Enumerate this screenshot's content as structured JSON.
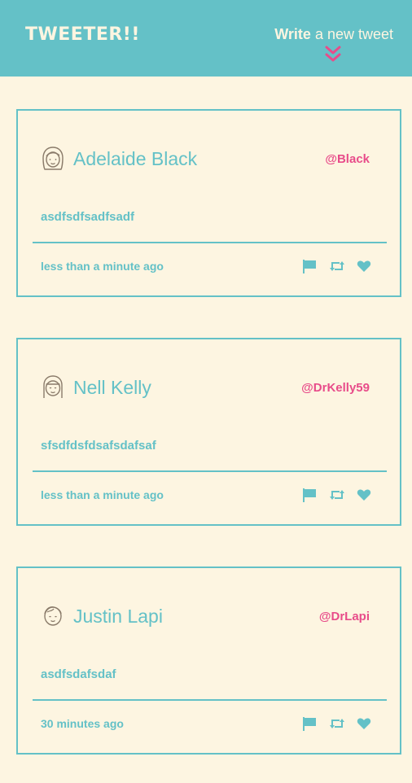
{
  "header": {
    "brand": "TWEETER!!",
    "compose_bold": "Write",
    "compose_rest": " a new tweet",
    "compose_icon": "double-chevron-down-icon"
  },
  "colors": {
    "background": "#fdf5e1",
    "accent": "#64c1c7",
    "handle": "#e84c8a"
  },
  "tweets": [
    {
      "name": "Adelaide Black",
      "handle": "@Black",
      "content": "asdfsdfsadfsadf",
      "time": "less than a minute ago",
      "avatar": "woman-face-icon"
    },
    {
      "name": "Nell Kelly",
      "handle": "@DrKelly59",
      "content": "sfsdfdsfdsafsdafsaf",
      "time": "less than a minute ago",
      "avatar": "girl-face-icon"
    },
    {
      "name": "Justin Lapi",
      "handle": "@DrLapi",
      "content": "asdfsdafsdaf",
      "time": "30 minutes ago",
      "avatar": "man-face-icon"
    }
  ],
  "actions": [
    "flag-icon",
    "retweet-icon",
    "heart-icon"
  ]
}
